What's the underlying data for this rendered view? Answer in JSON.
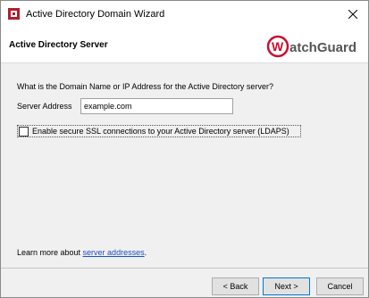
{
  "window": {
    "title": "Active Directory Domain Wizard"
  },
  "header": {
    "title": "Active Directory Server",
    "logo_text": "WatchGuard"
  },
  "form": {
    "question": "What is the Domain Name or IP Address for the Active Directory server?",
    "server_address_label": "Server Address",
    "server_address_value": "example.com",
    "ssl_checkbox_label": "Enable secure SSL connections to your Active Directory server (LDAPS)",
    "ssl_checked": false
  },
  "learn_more": {
    "prefix": "Learn more about ",
    "link_text": "server addresses",
    "suffix": "."
  },
  "buttons": {
    "back": "< Back",
    "next": "Next >",
    "cancel": "Cancel"
  },
  "colors": {
    "accent": "#0078d7",
    "link": "#1a50c4",
    "brand_red": "#c8102e"
  }
}
